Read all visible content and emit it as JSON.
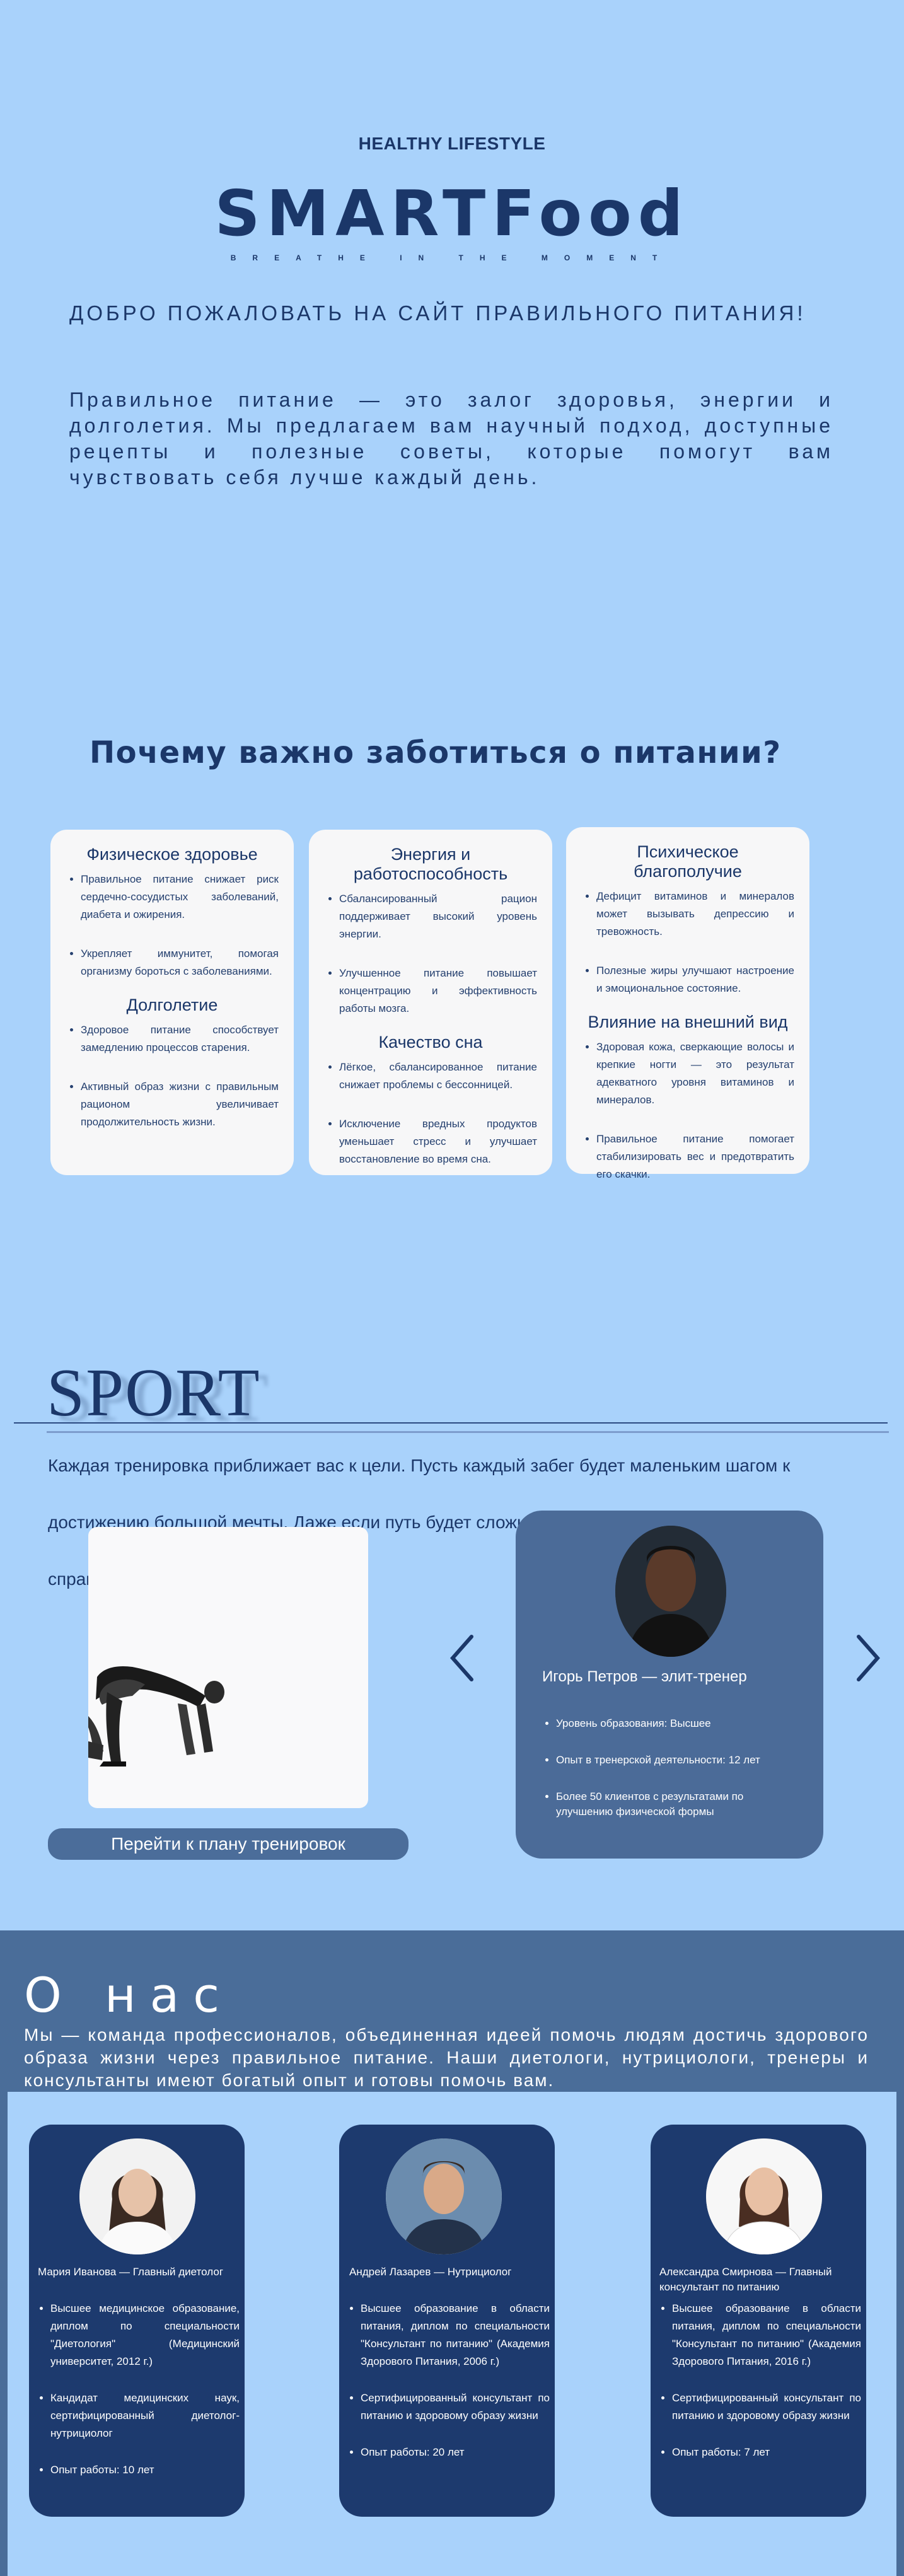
{
  "hero": {
    "kicker": "HEALTHY LIFESTYLE",
    "logo": "SMARTFood",
    "tagline": "BREATHE IN THE MOMENT",
    "welcome": "Добро пожаловать на сайт правильного питания!",
    "intro": "Правильное питание — это залог здоровья, энергии и долголетия. Мы предлагаем вам научный подход, доступные рецепты и полезные советы, которые помогут вам чувствовать себя лучше каждый день."
  },
  "why": {
    "title": "Почему важно заботиться о питании?",
    "cards": [
      {
        "sections": [
          {
            "title": "Физическое здоровье",
            "items": [
              "Правильное питание снижает риск сердечно-сосудистых заболеваний, диабета и ожирения.",
              "Укрепляет иммунитет, помогая организму бороться с заболеваниями."
            ]
          },
          {
            "title": "Долголетие",
            "items": [
              "Здоровое питание способствует замедлению процессов старения.",
              "Активный образ жизни с правильным рационом увеличивает продолжительность жизни."
            ]
          }
        ]
      },
      {
        "sections": [
          {
            "title": "Энергия и работоспособность",
            "items": [
              "Сбалансированный рацион поддерживает высокий уровень энергии.",
              "Улучшенное питание повышает концентрацию и эффективность работы мозга."
            ]
          },
          {
            "title": "Качество сна",
            "items": [
              "Лёгкое, сбалансированное питание снижает проблемы с бессонницей.",
              "Исключение вредных продуктов уменьшает стресс и улучшает восстановление во время сна."
            ]
          }
        ]
      },
      {
        "sections": [
          {
            "title": "Психическое благополучие",
            "items": [
              "Дефицит витаминов и минералов может вызывать депрессию и тревожность.",
              "Полезные жиры улучшают настроение и эмоциональное состояние."
            ]
          },
          {
            "title": "Влияние на внешний вид",
            "items": [
              "Здоровая кожа, сверкающие волосы и крепкие ногти — это результат адекватного уровня витаминов и минералов.",
              "Правильное питание помогает стабилизировать вес и предотвратить его скачки."
            ]
          }
        ]
      }
    ]
  },
  "sport": {
    "title": "SPORT",
    "text": "Каждая тренировка приближает вас к цели. Пусть каждый забег будет маленьким шагом к достижению большой мечты. Даже если путь будет сложным, помните: шаг за шагом, и вы справитесь!",
    "plan_button": "Перейти к плану тренировок",
    "prev_arrow": "‹",
    "next_arrow": "›",
    "trainer": {
      "name": "Игорь Петров — элит-тренер",
      "items": [
        "Уровень образования: Высшее",
        "Опыт в тренерской деятельности: 12 лет",
        "Более 50 клиентов с результатами по улучшению физической формы"
      ]
    }
  },
  "about": {
    "title": "О нас",
    "text": "Мы — команда профессионалов, объединенная идеей помочь людям достичь здорового образа жизни через правильное питание. Наши диетологи, нутрициологи, тренеры и консультанты имеют богатый опыт и готовы помочь вам.",
    "team": [
      {
        "name": "Мария Иванова — Главный диетолог",
        "items": [
          "Высшее медицинское образование, диплом по специальности \"Диетология\" (Медицинский университет, 2012 г.)",
          "Кандидат медицинских наук, сертифицированный диетолог-нутрициолог",
          "Опыт работы: 10 лет"
        ]
      },
      {
        "name": "Андрей Лазарев — Нутрициолог",
        "items": [
          "Высшее образование в области питания, диплом по специальности \"Консультант по питанию\" (Академия Здорового Питания, 2006 г.)",
          "Сертифицированный консультант по питанию и здоровому образу жизни",
          "Опыт работы: 20 лет"
        ]
      },
      {
        "name": "Александра Смирнова — Главный консультант по питанию",
        "items": [
          "Высшее образование в области питания, диплом по специальности \"Консультант по питанию\" (Академия Здорового Питания, 2016 г.)",
          "Сертифицированный консультант по питанию и здоровому образу жизни",
          "Опыт работы: 7 лет"
        ]
      }
    ]
  }
}
